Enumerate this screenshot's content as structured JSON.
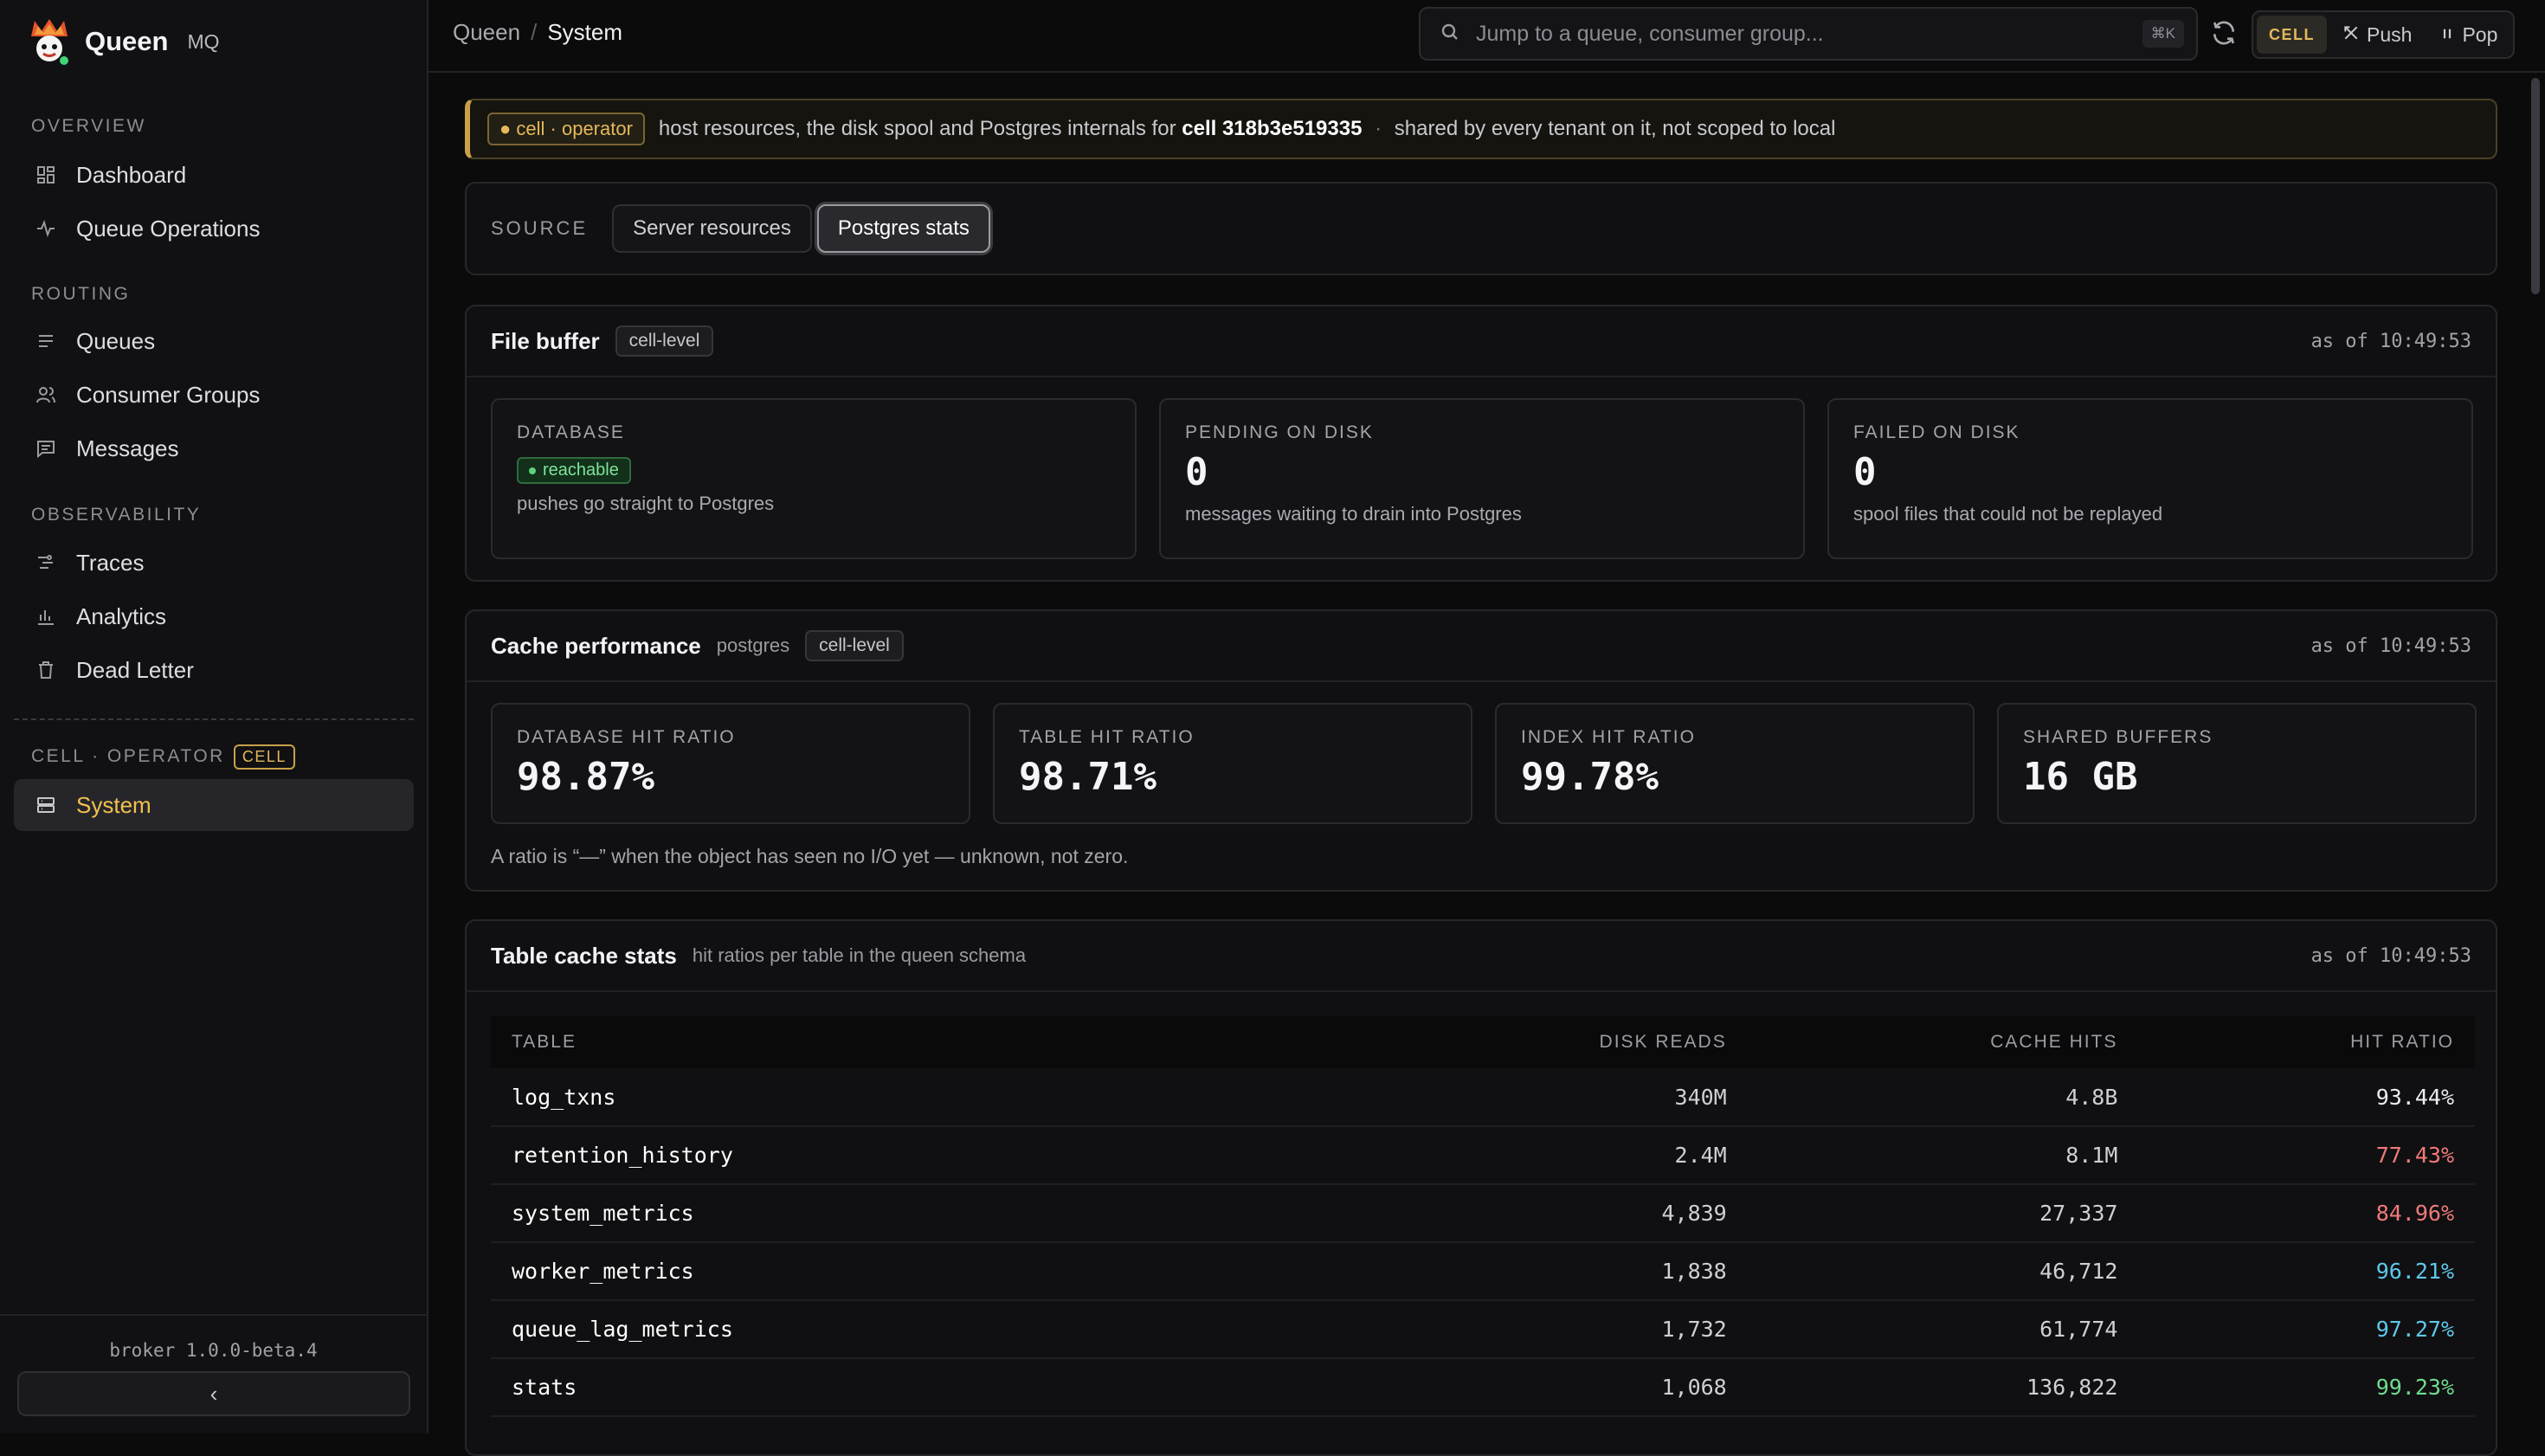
{
  "brand": {
    "name": "Queen",
    "suffix": "MQ"
  },
  "sidebar": {
    "sections": [
      {
        "label": "OVERVIEW"
      },
      {
        "label": "ROUTING"
      },
      {
        "label": "OBSERVABILITY"
      },
      {
        "label": "CELL · OPERATOR",
        "badge": "CELL"
      }
    ],
    "items": [
      {
        "label": "Dashboard",
        "icon": "grid-icon"
      },
      {
        "label": "Queue Operations",
        "icon": "activity-icon"
      },
      {
        "label": "Queues",
        "icon": "list-icon"
      },
      {
        "label": "Consumer Groups",
        "icon": "users-icon"
      },
      {
        "label": "Messages",
        "icon": "message-icon"
      },
      {
        "label": "Traces",
        "icon": "trace-icon"
      },
      {
        "label": "Analytics",
        "icon": "bar-chart-icon"
      },
      {
        "label": "Dead Letter",
        "icon": "trash-icon"
      },
      {
        "label": "System",
        "icon": "server-icon",
        "active": true
      }
    ],
    "version": "broker 1.0.0-beta.4",
    "collapse_glyph": "‹"
  },
  "topbar": {
    "breadcrumb": [
      "Queen",
      "/",
      "System"
    ],
    "search_placeholder": "Jump to a queue, consumer group...",
    "search_shortcut": "⌘K",
    "modes": [
      {
        "label": "CELL"
      },
      {
        "label": "Push",
        "icon": "push-icon"
      },
      {
        "label": "Pop",
        "icon": "pause-icon"
      }
    ]
  },
  "banner": {
    "tag": "cell · operator",
    "text1": "host resources, the disk spool and Postgres internals for",
    "cell_id": "cell 318b3e519335",
    "sep": "·",
    "text2": "shared by every tenant on it, not scoped to local"
  },
  "source": {
    "label": "SOURCE",
    "options": [
      "Server resources",
      "Postgres stats"
    ],
    "selected": "Postgres stats"
  },
  "file_buffer": {
    "title": "File buffer",
    "chip": "cell-level",
    "as_of": "as of 10:49:53",
    "tiles": [
      {
        "label": "DATABASE",
        "status": "reachable",
        "desc": "pushes go straight to Postgres"
      },
      {
        "label": "PENDING ON DISK",
        "value": "0",
        "desc": "messages waiting to drain into Postgres"
      },
      {
        "label": "FAILED ON DISK",
        "value": "0",
        "desc": "spool files that could not be replayed"
      }
    ]
  },
  "cache_perf": {
    "title": "Cache performance",
    "sub": "postgres",
    "chip": "cell-level",
    "as_of": "as of 10:49:53",
    "tiles": [
      {
        "label": "DATABASE HIT RATIO",
        "value": "98.87%"
      },
      {
        "label": "TABLE HIT RATIO",
        "value": "98.71%"
      },
      {
        "label": "INDEX HIT RATIO",
        "value": "99.78%"
      },
      {
        "label": "SHARED BUFFERS",
        "value": "16 GB"
      }
    ],
    "note": "A ratio is “—” when the object has seen no I/O yet — unknown, not zero."
  },
  "table_cache": {
    "title": "Table cache stats",
    "sub": "hit ratios per table in the queen schema",
    "as_of": "as of 10:49:53",
    "columns": [
      "TABLE",
      "DISK READS",
      "CACHE HITS",
      "HIT RATIO"
    ],
    "rows": [
      {
        "table": "log_txns",
        "reads": "340M",
        "hits": "4.8B",
        "ratio": "93.44%",
        "tone": "plain"
      },
      {
        "table": "retention_history",
        "reads": "2.4M",
        "hits": "8.1M",
        "ratio": "77.43%",
        "tone": "red"
      },
      {
        "table": "system_metrics",
        "reads": "4,839",
        "hits": "27,337",
        "ratio": "84.96%",
        "tone": "red"
      },
      {
        "table": "worker_metrics",
        "reads": "1,838",
        "hits": "46,712",
        "ratio": "96.21%",
        "tone": "blue"
      },
      {
        "table": "queue_lag_metrics",
        "reads": "1,732",
        "hits": "61,774",
        "ratio": "97.27%",
        "tone": "blue"
      },
      {
        "table": "stats",
        "reads": "1,068",
        "hits": "136,822",
        "ratio": "99.23%",
        "tone": "green"
      }
    ]
  },
  "colors": {
    "accent": "#f2c14e",
    "danger": "#f07a78",
    "info": "#5ec8ea",
    "ok": "#6fdc8c"
  }
}
